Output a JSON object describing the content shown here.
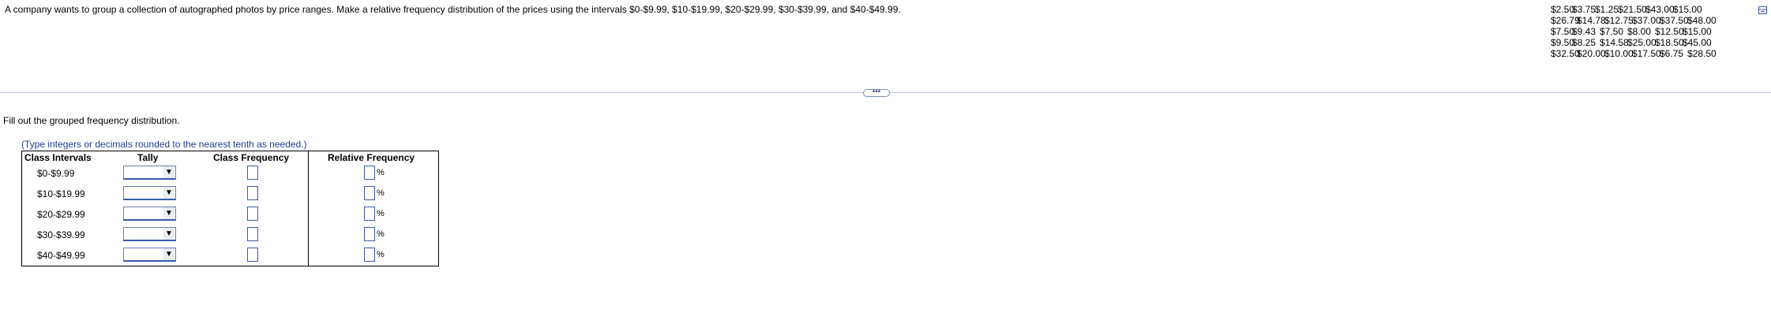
{
  "question": {
    "text": "A company wants to group a collection of autographed photos by price ranges. Make a relative frequency distribution of the prices using the intervals $0-$9.99, $10-$19.99, $20-$29.99, $30-$39.99, and $40-$49.99."
  },
  "data_panel": {
    "rows": [
      [
        "$2.50",
        "$3.75",
        "$1.25",
        "$21.50",
        "$43.00",
        "$15.00"
      ],
      [
        "$26.79",
        "$14.78",
        "$12.75",
        "$37.00",
        "$37.50",
        "$48.00"
      ],
      [
        "$7.50",
        "$9.43",
        "$7.50",
        "$8.00",
        "$12.50",
        "$15.00"
      ],
      [
        "$9.50",
        "$8.25",
        "$14.58",
        "$25.00",
        "$18.50",
        "$45.00"
      ],
      [
        "$32.50",
        "$20.00",
        "$10.00",
        "$17.50",
        "$6.75",
        "$28.50"
      ]
    ],
    "copy_icon": "copy-icon"
  },
  "more_button": {
    "label": "•••"
  },
  "instruction": {
    "text": "Fill out the grouped frequency distribution."
  },
  "hint": {
    "text": "(Type integers or decimals rounded to the nearest tenth as needed.)"
  },
  "table": {
    "headers": {
      "class_intervals": "Class Intervals",
      "tally": "Tally",
      "class_frequency": "Class Frequency",
      "relative_frequency": "Relative Frequency"
    },
    "rows": [
      {
        "interval": "$0-$9.99",
        "tally": "",
        "class_frequency": "",
        "relative_frequency": ""
      },
      {
        "interval": "$10-$19.99",
        "tally": "",
        "class_frequency": "",
        "relative_frequency": ""
      },
      {
        "interval": "$20-$29.99",
        "tally": "",
        "class_frequency": "",
        "relative_frequency": ""
      },
      {
        "interval": "$30-$39.99",
        "tally": "",
        "class_frequency": "",
        "relative_frequency": ""
      },
      {
        "interval": "$40-$49.99",
        "tally": "",
        "class_frequency": "",
        "relative_frequency": ""
      }
    ],
    "percent_sign": "%",
    "dropdown_arrow": "▼"
  },
  "colors": {
    "hint_text": "#1f3b94",
    "input_border": "#3a5ba9",
    "divider": "#b9c3d6"
  }
}
